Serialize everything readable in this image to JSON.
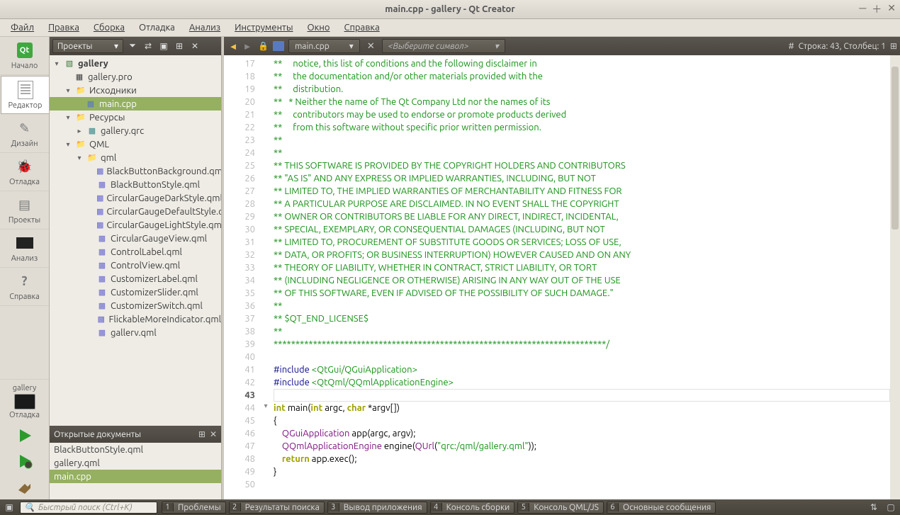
{
  "window": {
    "title": "main.cpp - gallery - Qt Creator"
  },
  "menu": [
    "Файл",
    "Правка",
    "Сборка",
    "Отладка",
    "Анализ",
    "Инструменты",
    "Окно",
    "Справка"
  ],
  "modes": {
    "start": "Начало",
    "editor": "Редактор",
    "design": "Дизайн",
    "debug": "Отладка",
    "projects": "Проекты",
    "analyze": "Анализ",
    "help": "Справка"
  },
  "target": {
    "kit": "gallery",
    "config": "Отладка"
  },
  "side": {
    "combo": "Проекты",
    "tree": {
      "root": "gallery",
      "pro": "gallery.pro",
      "sources": "Исходники",
      "maincpp": "main.cpp",
      "resources": "Ресурсы",
      "qrc": "gallery.qrc",
      "qml_group": "QML",
      "qml_folder": "qml",
      "files": [
        "BlackButtonBackground.qml",
        "BlackButtonStyle.qml",
        "CircularGaugeDarkStyle.qml",
        "CircularGaugeDefaultStyle.qml",
        "CircularGaugeLightStyle.qml",
        "CircularGaugeView.qml",
        "ControlLabel.qml",
        "ControlView.qml",
        "CustomizerLabel.qml",
        "CustomizerSlider.qml",
        "CustomizerSwitch.qml",
        "FlickableMoreIndicator.qml",
        "gallerv.qml"
      ]
    },
    "open_docs_title": "Открытые документы",
    "open_docs": [
      "BlackButtonStyle.qml",
      "gallery.qml",
      "main.cpp"
    ]
  },
  "editor": {
    "file": "main.cpp",
    "symbol_placeholder": "<Выберите символ>",
    "cursor": "Строка: 43, Столбец: 1",
    "first_line": 17,
    "code": [
      {
        "t": "comment",
        "s": "**     notice, this list of conditions and the following disclaimer in"
      },
      {
        "t": "comment",
        "s": "**     the documentation and/or other materials provided with the"
      },
      {
        "t": "comment",
        "s": "**     distribution."
      },
      {
        "t": "comment",
        "s": "**   * Neither the name of The Qt Company Ltd nor the names of its"
      },
      {
        "t": "comment",
        "s": "**     contributors may be used to endorse or promote products derived"
      },
      {
        "t": "comment",
        "s": "**     from this software without specific prior written permission."
      },
      {
        "t": "comment",
        "s": "**"
      },
      {
        "t": "comment",
        "s": "**"
      },
      {
        "t": "comment",
        "s": "** THIS SOFTWARE IS PROVIDED BY THE COPYRIGHT HOLDERS AND CONTRIBUTORS"
      },
      {
        "t": "comment",
        "s": "** \"AS IS\" AND ANY EXPRESS OR IMPLIED WARRANTIES, INCLUDING, BUT NOT"
      },
      {
        "t": "comment",
        "s": "** LIMITED TO, THE IMPLIED WARRANTIES OF MERCHANTABILITY AND FITNESS FOR"
      },
      {
        "t": "comment",
        "s": "** A PARTICULAR PURPOSE ARE DISCLAIMED. IN NO EVENT SHALL THE COPYRIGHT"
      },
      {
        "t": "comment",
        "s": "** OWNER OR CONTRIBUTORS BE LIABLE FOR ANY DIRECT, INDIRECT, INCIDENTAL,"
      },
      {
        "t": "comment",
        "s": "** SPECIAL, EXEMPLARY, OR CONSEQUENTIAL DAMAGES (INCLUDING, BUT NOT"
      },
      {
        "t": "comment",
        "s": "** LIMITED TO, PROCUREMENT OF SUBSTITUTE GOODS OR SERVICES; LOSS OF USE,"
      },
      {
        "t": "comment",
        "s": "** DATA, OR PROFITS; OR BUSINESS INTERRUPTION) HOWEVER CAUSED AND ON ANY"
      },
      {
        "t": "comment",
        "s": "** THEORY OF LIABILITY, WHETHER IN CONTRACT, STRICT LIABILITY, OR TORT"
      },
      {
        "t": "comment",
        "s": "** (INCLUDING NEGLIGENCE OR OTHERWISE) ARISING IN ANY WAY OUT OF THE USE"
      },
      {
        "t": "comment",
        "s": "** OF THIS SOFTWARE, EVEN IF ADVISED OF THE POSSIBILITY OF SUCH DAMAGE.\""
      },
      {
        "t": "comment",
        "s": "**"
      },
      {
        "t": "comment",
        "s": "** $QT_END_LICENSE$"
      },
      {
        "t": "comment",
        "s": "**"
      },
      {
        "t": "comment",
        "s": "****************************************************************************/"
      },
      {
        "t": "blank",
        "s": ""
      },
      {
        "t": "include",
        "pp": "#include ",
        "inc": "<QtGui/QGuiApplication>"
      },
      {
        "t": "include",
        "pp": "#include ",
        "inc": "<QtQml/QQmlApplicationEngine>"
      },
      {
        "t": "blank",
        "s": "",
        "current": true
      },
      {
        "t": "main_sig"
      },
      {
        "t": "plain",
        "s": "{"
      },
      {
        "t": "l46"
      },
      {
        "t": "l47"
      },
      {
        "t": "l48"
      },
      {
        "t": "plain",
        "s": "}"
      },
      {
        "t": "blank",
        "s": ""
      }
    ]
  },
  "bottom": {
    "search_placeholder": "Быстрый поиск (Ctrl+K)",
    "panes": [
      "Проблемы",
      "Результаты поиска",
      "Вывод приложения",
      "Консоль сборки",
      "Консоль QML/JS",
      "Основные сообщения"
    ]
  }
}
